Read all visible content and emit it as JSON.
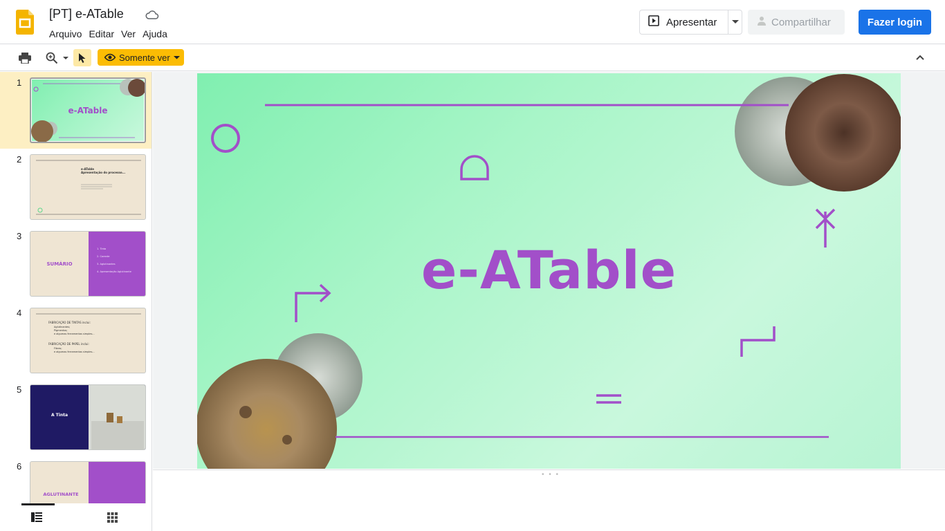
{
  "app": {
    "doc_title": "[PT] e-ATable",
    "menu": [
      "Arquivo",
      "Editar",
      "Ver",
      "Ajuda"
    ],
    "present_label": "Apresentar",
    "share_label": "Compartilhar",
    "login_label": "Fazer login",
    "view_mode_label": "Somente ver",
    "brand_color": "#fbbc04",
    "accent_color": "#1a73e8"
  },
  "slides": [
    {
      "number": "1",
      "title": "e-ATable"
    },
    {
      "number": "2",
      "title": "e-ATable",
      "subtitle": "Apresentação do processo..."
    },
    {
      "number": "3",
      "title": "SUMÁRIO",
      "items": [
        "1. Tinta",
        "2. Corante",
        "3. Aglutinantes",
        "4. Apresentação Aglutinante"
      ]
    },
    {
      "number": "4",
      "lines": [
        "FABRICAÇÃO DE TINTAS inclui:",
        "Aglutinantes;",
        "Pigmentos;",
        "e algumas ferramentas simples...",
        "FABRICAÇÃO DE PAPEL inclui:",
        "Fibras;",
        "e algumas ferramentas simples..."
      ]
    },
    {
      "number": "5",
      "title": "A Tinta"
    },
    {
      "number": "6",
      "title": "AGLUTINANTE"
    }
  ],
  "current_slide": {
    "title": "e-ATable",
    "title_color": "#a24fc9",
    "background_color": "#a8f5c8"
  }
}
